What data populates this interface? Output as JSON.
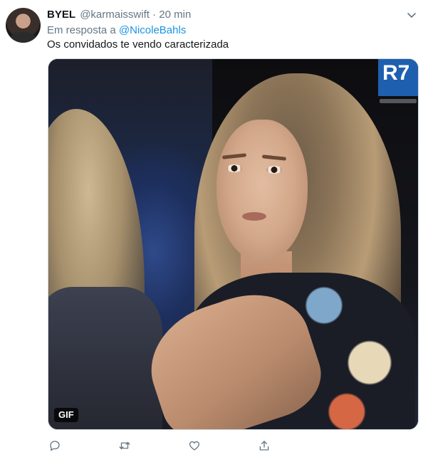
{
  "tweet": {
    "author_name": "BYEL",
    "author_handle": "@karmaisswift",
    "separator": "·",
    "time": "20 min",
    "reply_prefix": "Em resposta a ",
    "reply_mention": "@NicoleBahls",
    "text": "Os convidados te vendo caracterizada",
    "media": {
      "badge": "GIF",
      "broadcast_logo": "R7"
    },
    "actions": [
      {
        "icon": "reply-icon"
      },
      {
        "icon": "retweet-icon"
      },
      {
        "icon": "like-icon"
      },
      {
        "icon": "share-icon"
      }
    ]
  },
  "colors": {
    "link": "#1b95e0",
    "secondary_text": "#657786",
    "primary_text": "#14171a",
    "border": "#ccd6dd"
  }
}
